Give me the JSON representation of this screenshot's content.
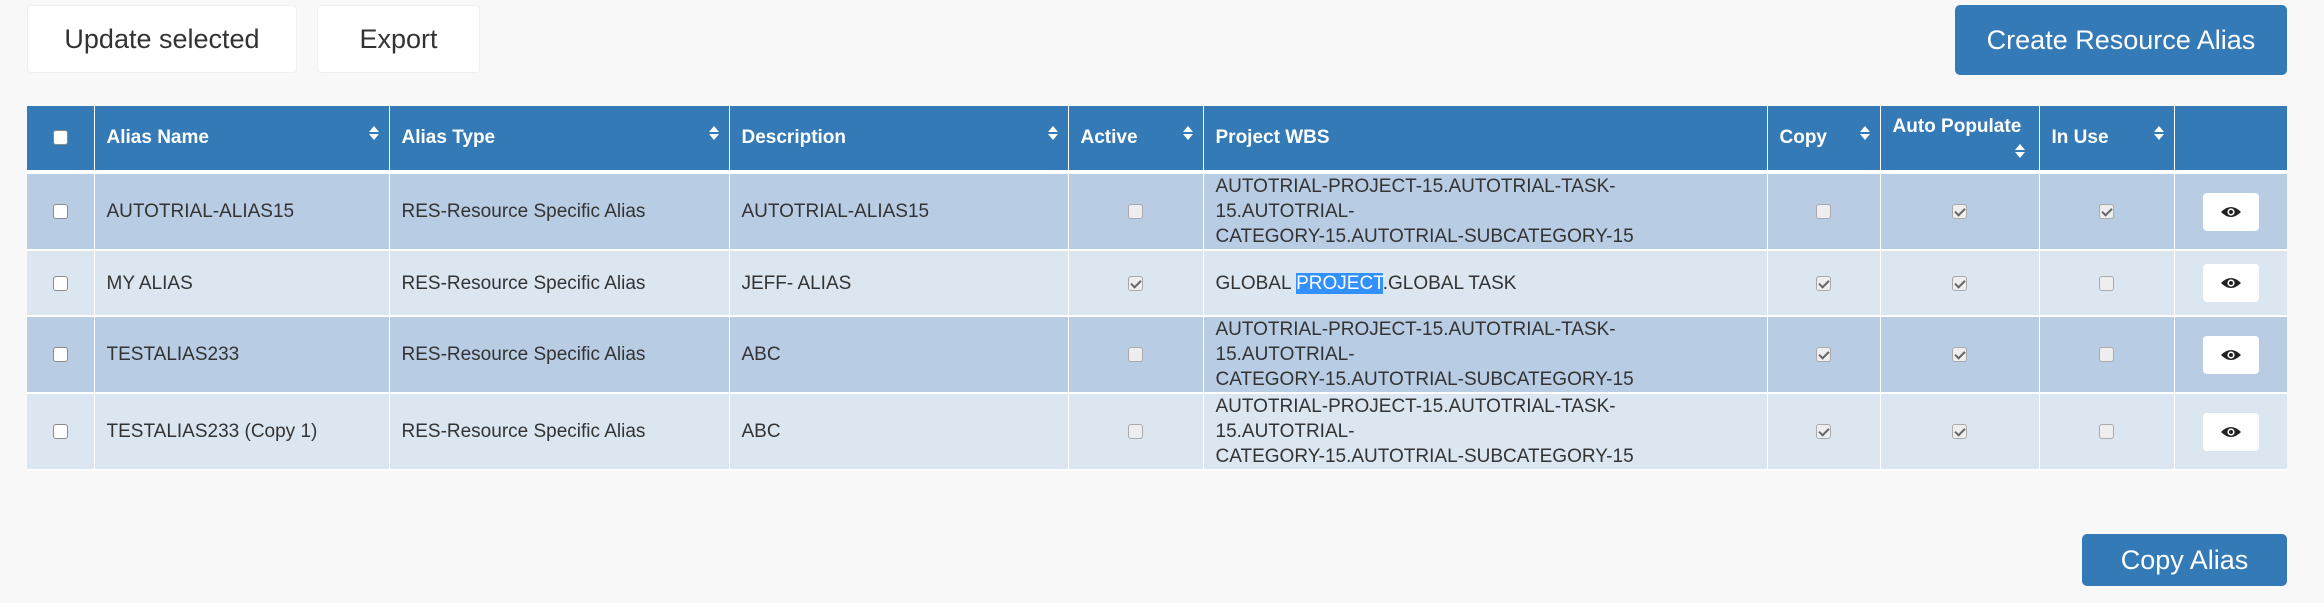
{
  "toolbar": {
    "update_label": "Update selected",
    "export_label": "Export",
    "create_label": "Create Resource Alias"
  },
  "table": {
    "headers": {
      "alias_name": "Alias Name",
      "alias_type": "Alias Type",
      "description": "Description",
      "active": "Active",
      "project_wbs": "Project WBS",
      "copy": "Copy",
      "auto_populate": "Auto Populate",
      "in_use": "In Use"
    },
    "rows": [
      {
        "alias_name": "AUTOTRIAL-ALIAS15",
        "alias_type": "RES-Resource Specific Alias",
        "description": "AUTOTRIAL-ALIAS15",
        "active": false,
        "wbs_line1": "AUTOTRIAL-PROJECT-15.AUTOTRIAL-TASK-15.AUTOTRIAL-",
        "wbs_line2": "CATEGORY-15.AUTOTRIAL-SUBCATEGORY-15",
        "copy": false,
        "auto_populate": true,
        "in_use": true
      },
      {
        "alias_name": "MY ALIAS",
        "alias_type": "RES-Resource Specific Alias",
        "description": "JEFF- ALIAS",
        "active": true,
        "wbs_part1": "GLOBAL ",
        "wbs_highlight": "PROJECT",
        "wbs_part2": ".GLOBAL TASK",
        "copy": true,
        "auto_populate": true,
        "in_use": false
      },
      {
        "alias_name": "TESTALIAS233",
        "alias_type": "RES-Resource Specific Alias",
        "description": "ABC",
        "active": false,
        "wbs_line1": "AUTOTRIAL-PROJECT-15.AUTOTRIAL-TASK-15.AUTOTRIAL-",
        "wbs_line2": "CATEGORY-15.AUTOTRIAL-SUBCATEGORY-15",
        "copy": true,
        "auto_populate": true,
        "in_use": false
      },
      {
        "alias_name": "TESTALIAS233 (Copy 1)",
        "alias_type": "RES-Resource Specific Alias",
        "description": "ABC",
        "active": false,
        "wbs_line1": "AUTOTRIAL-PROJECT-15.AUTOTRIAL-TASK-15.AUTOTRIAL-",
        "wbs_line2": "CATEGORY-15.AUTOTRIAL-SUBCATEGORY-15",
        "copy": true,
        "auto_populate": true,
        "in_use": false
      }
    ]
  },
  "footer": {
    "copy_alias_label": "Copy Alias"
  },
  "icons": {
    "view": "eye-icon",
    "sort": "sort-icon"
  },
  "colors": {
    "header_bg": "#337ab7",
    "row_odd": "#b8cce4",
    "row_even": "#dce6f1",
    "selection": "#3390ff"
  }
}
